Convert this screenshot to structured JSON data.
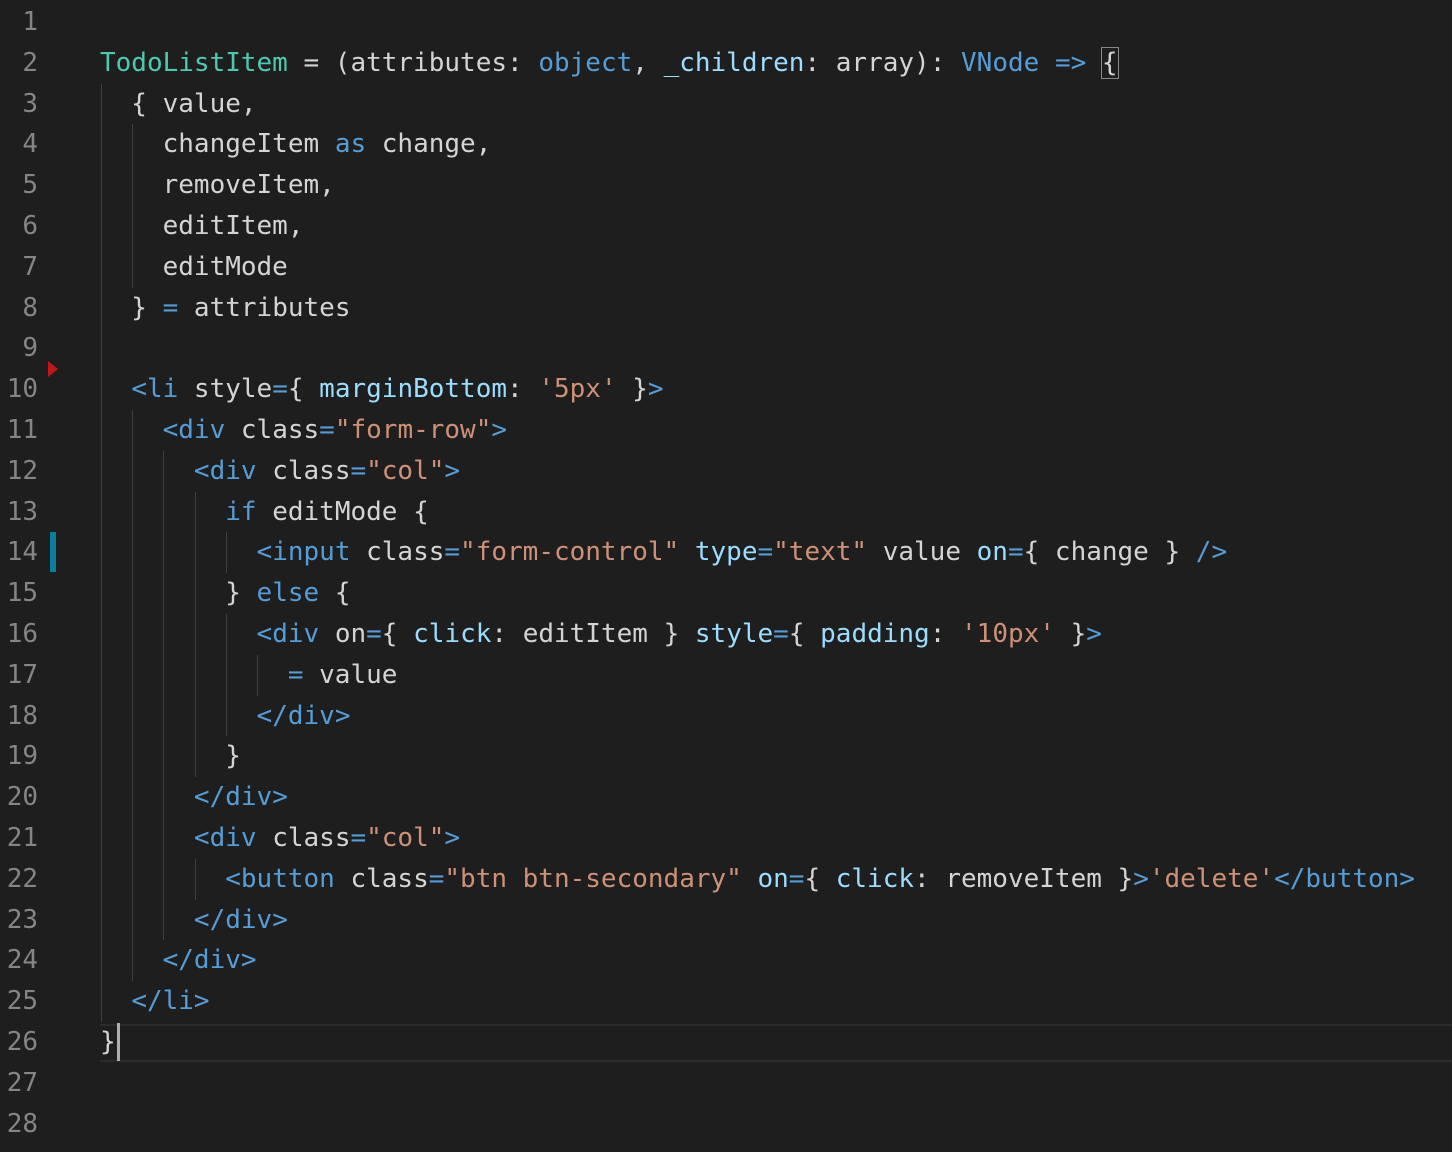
{
  "editor": {
    "theme": {
      "background": "#1e1e1e",
      "line_number_color": "#858585",
      "modified_indicator_color": "#0c7d9d",
      "fold_marker_color": "#c01818"
    },
    "line_numbers": [
      "1",
      "2",
      "3",
      "4",
      "5",
      "6",
      "7",
      "8",
      "9",
      "10",
      "11",
      "12",
      "13",
      "14",
      "15",
      "16",
      "17",
      "18",
      "19",
      "20",
      "21",
      "22",
      "23",
      "24",
      "25",
      "26",
      "27",
      "28"
    ],
    "modified_line": 14,
    "fold_marker_line": 10,
    "cursor_line": 26,
    "lines": [
      [],
      [
        [
          "typ",
          "TodoListItem"
        ],
        [
          "pl",
          " = ("
        ],
        [
          "pl",
          "attributes"
        ],
        [
          "pl",
          ": "
        ],
        [
          "kw",
          "object"
        ],
        [
          "pl",
          ", "
        ],
        [
          "attr",
          "_children"
        ],
        [
          "pl",
          ": "
        ],
        [
          "pl",
          "array"
        ],
        [
          "pl",
          "): "
        ],
        [
          "kw",
          "VNode"
        ],
        [
          "pl",
          " "
        ],
        [
          "kw",
          "=>"
        ],
        [
          "pl",
          " "
        ],
        [
          "brace",
          "{"
        ]
      ],
      [
        [
          "pl",
          "  { value,"
        ]
      ],
      [
        [
          "pl",
          "    changeItem "
        ],
        [
          "kw",
          "as"
        ],
        [
          "pl",
          " change,"
        ]
      ],
      [
        [
          "pl",
          "    removeItem,"
        ]
      ],
      [
        [
          "pl",
          "    editItem,"
        ]
      ],
      [
        [
          "pl",
          "    editMode"
        ]
      ],
      [
        [
          "pl",
          "  } "
        ],
        [
          "kw",
          "="
        ],
        [
          "pl",
          " attributes"
        ]
      ],
      [],
      [
        [
          "pl",
          "  "
        ],
        [
          "tag",
          "<li"
        ],
        [
          "pl",
          " style"
        ],
        [
          "kw",
          "="
        ],
        [
          "pl",
          "{ "
        ],
        [
          "attr",
          "marginBottom"
        ],
        [
          "pl",
          ": "
        ],
        [
          "str",
          "'5px'"
        ],
        [
          "pl",
          " }"
        ],
        [
          "tag",
          ">"
        ]
      ],
      [
        [
          "pl",
          "    "
        ],
        [
          "tag",
          "<div"
        ],
        [
          "pl",
          " class"
        ],
        [
          "kw",
          "="
        ],
        [
          "str",
          "\"form-row\""
        ],
        [
          "tag",
          ">"
        ]
      ],
      [
        [
          "pl",
          "      "
        ],
        [
          "tag",
          "<div"
        ],
        [
          "pl",
          " class"
        ],
        [
          "kw",
          "="
        ],
        [
          "str",
          "\"col\""
        ],
        [
          "tag",
          ">"
        ]
      ],
      [
        [
          "pl",
          "        "
        ],
        [
          "kw",
          "if"
        ],
        [
          "pl",
          " editMode {"
        ]
      ],
      [
        [
          "pl",
          "          "
        ],
        [
          "tag",
          "<input"
        ],
        [
          "pl",
          " class"
        ],
        [
          "kw",
          "="
        ],
        [
          "str",
          "\"form-control\""
        ],
        [
          "pl",
          " "
        ],
        [
          "attr",
          "type"
        ],
        [
          "kw",
          "="
        ],
        [
          "str",
          "\"text\""
        ],
        [
          "pl",
          " value "
        ],
        [
          "attr",
          "on"
        ],
        [
          "kw",
          "="
        ],
        [
          "pl",
          "{ change } "
        ],
        [
          "tag",
          "/>"
        ]
      ],
      [
        [
          "pl",
          "        } "
        ],
        [
          "kw",
          "else"
        ],
        [
          "pl",
          " {"
        ]
      ],
      [
        [
          "pl",
          "          "
        ],
        [
          "tag",
          "<div"
        ],
        [
          "pl",
          " on"
        ],
        [
          "kw",
          "="
        ],
        [
          "pl",
          "{ "
        ],
        [
          "attr",
          "click"
        ],
        [
          "pl",
          ": editItem } "
        ],
        [
          "attr",
          "style"
        ],
        [
          "kw",
          "="
        ],
        [
          "pl",
          "{ "
        ],
        [
          "attr",
          "padding"
        ],
        [
          "pl",
          ": "
        ],
        [
          "str",
          "'10px'"
        ],
        [
          "pl",
          " }"
        ],
        [
          "tag",
          ">"
        ]
      ],
      [
        [
          "pl",
          "            "
        ],
        [
          "kw",
          "="
        ],
        [
          "pl",
          " value"
        ]
      ],
      [
        [
          "pl",
          "          "
        ],
        [
          "tag",
          "</div>"
        ]
      ],
      [
        [
          "pl",
          "        }"
        ]
      ],
      [
        [
          "pl",
          "      "
        ],
        [
          "tag",
          "</div>"
        ]
      ],
      [
        [
          "pl",
          "      "
        ],
        [
          "tag",
          "<div"
        ],
        [
          "pl",
          " class"
        ],
        [
          "kw",
          "="
        ],
        [
          "str",
          "\"col\""
        ],
        [
          "tag",
          ">"
        ]
      ],
      [
        [
          "pl",
          "        "
        ],
        [
          "tag",
          "<button"
        ],
        [
          "pl",
          " class"
        ],
        [
          "kw",
          "="
        ],
        [
          "str",
          "\"btn btn-secondary\""
        ],
        [
          "pl",
          " "
        ],
        [
          "attr",
          "on"
        ],
        [
          "kw",
          "="
        ],
        [
          "pl",
          "{ "
        ],
        [
          "attr",
          "click"
        ],
        [
          "pl",
          ": removeItem }"
        ],
        [
          "tag",
          ">"
        ],
        [
          "str",
          "'delete'"
        ],
        [
          "tag",
          "</button>"
        ]
      ],
      [
        [
          "pl",
          "      "
        ],
        [
          "tag",
          "</div>"
        ]
      ],
      [
        [
          "pl",
          "    "
        ],
        [
          "tag",
          "</div>"
        ]
      ],
      [
        [
          "pl",
          "  "
        ],
        [
          "tag",
          "</li>"
        ]
      ],
      [
        [
          "pl",
          "}"
        ]
      ],
      [],
      []
    ]
  }
}
